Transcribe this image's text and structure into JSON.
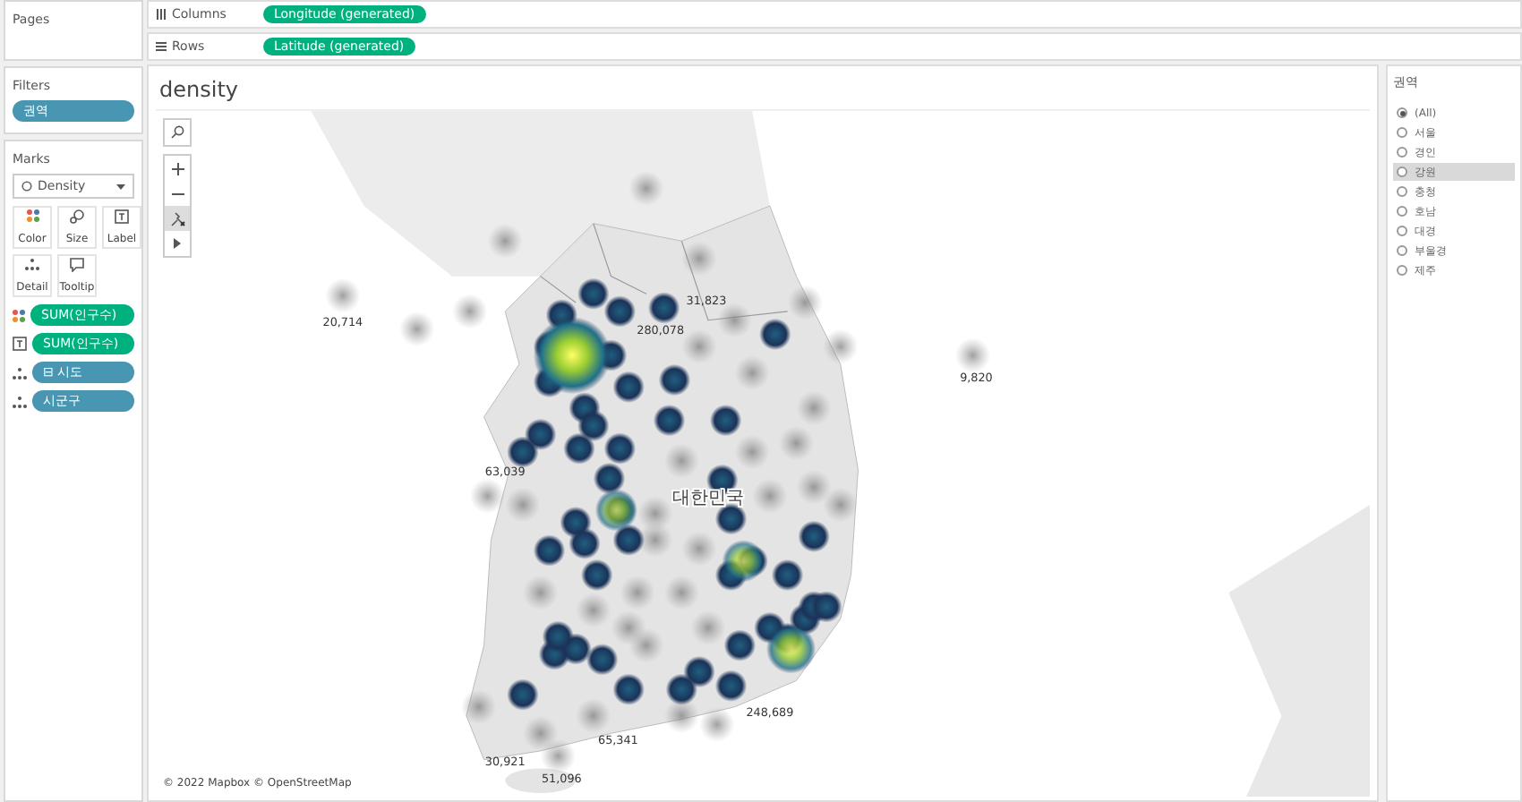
{
  "pages": {
    "title": "Pages"
  },
  "filters": {
    "title": "Filters",
    "pills": [
      "권역"
    ]
  },
  "marks": {
    "title": "Marks",
    "mark_type": "Density",
    "buttons": [
      {
        "label": "Color",
        "kind": "color"
      },
      {
        "label": "Size",
        "kind": "size"
      },
      {
        "label": "Label",
        "kind": "label"
      },
      {
        "label": "Detail",
        "kind": "detail"
      },
      {
        "label": "Tooltip",
        "kind": "tooltip"
      }
    ],
    "fields": [
      {
        "label": "SUM(인구수)",
        "kind": "color",
        "color": "#00b180"
      },
      {
        "label": "SUM(인구수)",
        "kind": "label",
        "color": "#00b180"
      },
      {
        "label": "⊟ 시도",
        "kind": "detail",
        "color": "#4996b2"
      },
      {
        "label": "시군구",
        "kind": "detail",
        "color": "#4996b2"
      }
    ]
  },
  "shelves": [
    {
      "label": "Columns",
      "kind": "columns",
      "pill": "Longitude (generated)"
    },
    {
      "label": "Rows",
      "kind": "rows",
      "pill": "Latitude (generated)"
    }
  ],
  "view": {
    "title": "density",
    "map_labels": [
      "20,714",
      "31,823",
      "280,078",
      "9,820",
      "63,039",
      "대한민국",
      "248,689",
      "65,341",
      "30,921",
      "51,096"
    ],
    "attribution": "© 2022 Mapbox © OpenStreetMap"
  },
  "legend": {
    "title": "권역",
    "options": [
      {
        "label": "(All)",
        "selected": true,
        "highlighted": false
      },
      {
        "label": "서울",
        "selected": false,
        "highlighted": false
      },
      {
        "label": "경인",
        "selected": false,
        "highlighted": false
      },
      {
        "label": "강원",
        "selected": false,
        "highlighted": true
      },
      {
        "label": "충청",
        "selected": false,
        "highlighted": false
      },
      {
        "label": "호남",
        "selected": false,
        "highlighted": false
      },
      {
        "label": "대경",
        "selected": false,
        "highlighted": false
      },
      {
        "label": "부울경",
        "selected": false,
        "highlighted": false
      },
      {
        "label": "제주",
        "selected": false,
        "highlighted": false
      }
    ]
  }
}
